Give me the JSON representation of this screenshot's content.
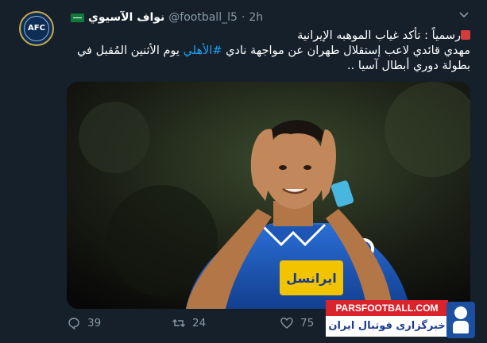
{
  "tweet": {
    "avatar": {
      "text": "AFC"
    },
    "header": {
      "dot": "",
      "display_name": "نواف الآسيوي",
      "handle": "@football_l5",
      "separator": "·",
      "time": "2h"
    },
    "text": {
      "line1": "رسمياً : تأكد غياب الموهبه الإيرانية",
      "line2_before_hashtag": "مهدي قائدي لاعب إستقلال طهران عن مواجهة نادي ",
      "hashtag": "#الأهلي",
      "line2_after_hashtag": " يوم الأثنين المُقبل في",
      "line3": "بطولة دوري أبطال آسيا .."
    },
    "media": {
      "sponsor_text": "ایرانسل"
    },
    "watermark": {
      "top": "PARSFOOTBALL.COM",
      "bottom": "خبرگزاری فوتبال ایران"
    },
    "actions": {
      "replies": "39",
      "retweets": "24",
      "likes": "75"
    },
    "colors": {
      "background": "#15202b",
      "secondary_text": "#8899a6",
      "link": "#1da1f2"
    }
  }
}
